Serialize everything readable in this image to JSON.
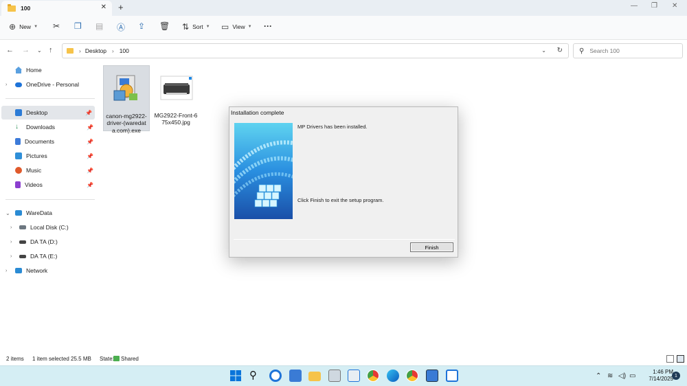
{
  "window": {
    "tab_title": "100",
    "tab_close": "✕",
    "new_tab": "+",
    "minimize": "—",
    "maximize": "❐",
    "close": "✕"
  },
  "toolbar": {
    "new_label": "New",
    "sort_label": "Sort",
    "view_label": "View",
    "more_label": "···"
  },
  "address": {
    "crumbs": [
      "Desktop",
      "100"
    ],
    "search_placeholder": "Search 100"
  },
  "sidebar": {
    "quick": [
      {
        "label": "Home",
        "icon": "home-icon"
      },
      {
        "label": "OneDrive - Personal",
        "icon": "cloud-icon"
      }
    ],
    "pinned": [
      {
        "label": "Desktop",
        "icon": "desktop-icon",
        "color": "#2b7bd6"
      },
      {
        "label": "Downloads",
        "icon": "download-icon",
        "color": "#1f8a4c"
      },
      {
        "label": "Documents",
        "icon": "document-icon",
        "color": "#3d7bd9"
      },
      {
        "label": "Pictures",
        "icon": "picture-icon",
        "color": "#2f8fd8"
      },
      {
        "label": "Music",
        "icon": "music-icon",
        "color": "#e05a2b"
      },
      {
        "label": "Videos",
        "icon": "video-icon",
        "color": "#8b3fcf"
      }
    ],
    "devices": [
      {
        "label": "WareData",
        "icon": "computer-icon"
      },
      {
        "label": "Local Disk (C:)",
        "icon": "drive-icon"
      },
      {
        "label": "DA TA (D:)",
        "icon": "drive-icon"
      },
      {
        "label": "DA TA (E:)",
        "icon": "drive-icon"
      },
      {
        "label": "Network",
        "icon": "network-icon"
      }
    ]
  },
  "files": [
    {
      "name": "canon-mg2922-driver-(waredata.com).exe",
      "icon": "installer-icon",
      "selected": true
    },
    {
      "name": "MG2922-Front-675x450.jpg",
      "icon": "printer-image-thumbnail",
      "selected": false
    }
  ],
  "dialog": {
    "title": "Installation  complete",
    "message1": "MP Drivers has been installed.",
    "message2": "Click Finish to exit the setup program.",
    "finish_label": "Finish"
  },
  "status": {
    "items": "2 items",
    "selected": "1 item selected  25.5 MB",
    "state_label": "State:",
    "state_value": "Shared"
  },
  "taskbar": {
    "time": "1:46 PM",
    "date": "7/14/2025",
    "notifications": "1"
  },
  "colors": {
    "accent": "#0067c0",
    "taskbar": "#d5eef4",
    "dialog_bg": "#f0f0f0"
  }
}
